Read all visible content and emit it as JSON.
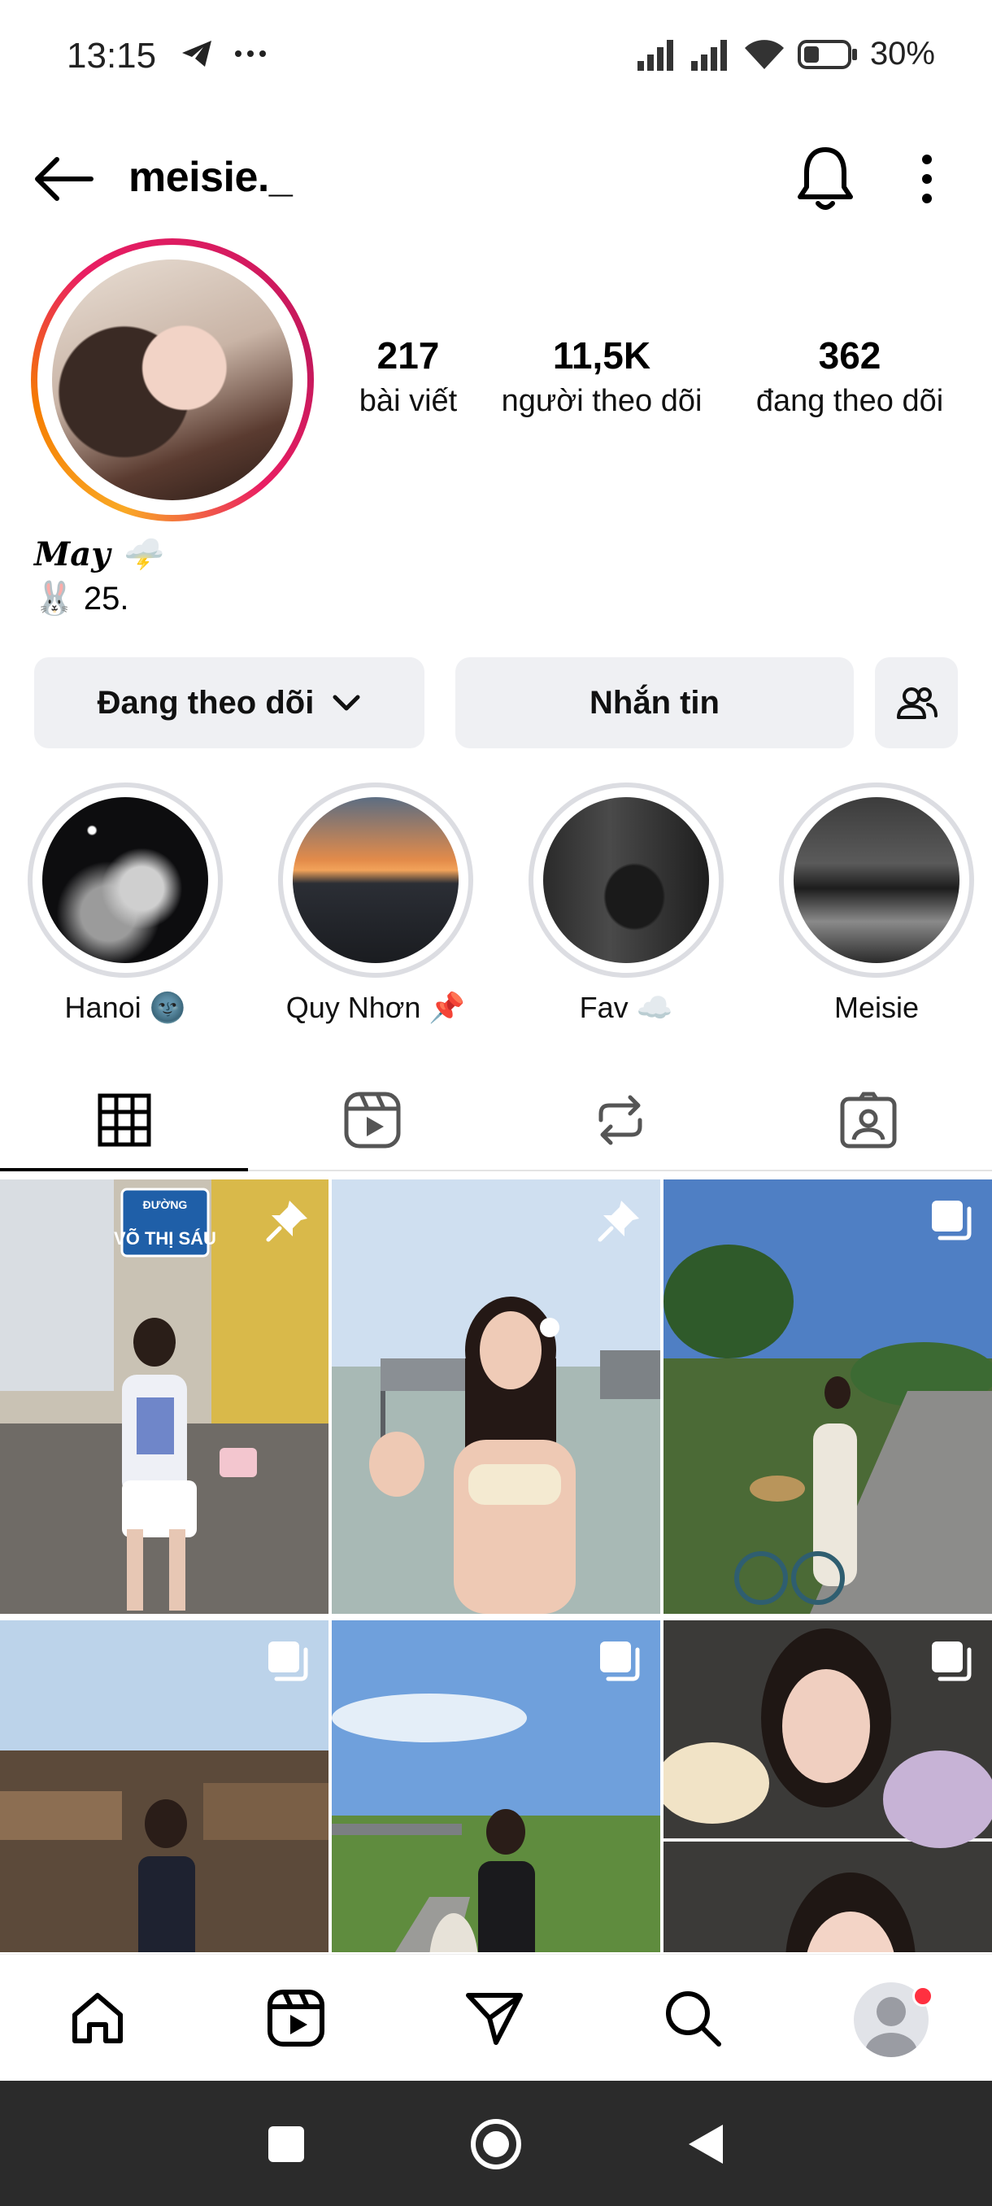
{
  "status_bar": {
    "time": "13:15",
    "battery_text": "30%",
    "icons": [
      "telegram-icon",
      "more-notifications-icon",
      "signal-icon",
      "signal-icon",
      "wifi-icon",
      "battery-icon"
    ]
  },
  "header": {
    "username": "meisie._",
    "icons": [
      "back-arrow-icon",
      "bell-icon",
      "more-vertical-icon"
    ]
  },
  "profile": {
    "stats": [
      {
        "value": "217",
        "label": "bài viết"
      },
      {
        "value": "11,5K",
        "label": "người theo dõi"
      },
      {
        "value": "362",
        "label": "đang theo dõi"
      }
    ],
    "bio_name": "May 🌩️",
    "bio_line": "🐰 25."
  },
  "actions": {
    "following_label": "Đang theo dõi",
    "message_label": "Nhắn tin"
  },
  "highlights": [
    {
      "label": "Hanoi 🌚"
    },
    {
      "label": "Quy Nhơn 📌"
    },
    {
      "label": "Fav ☁️"
    },
    {
      "label": "Meisie"
    }
  ],
  "tabs": [
    "grid-icon",
    "reels-icon",
    "reposts-icon",
    "tagged-icon"
  ],
  "posts": [
    {
      "pinned": true,
      "multi": false
    },
    {
      "pinned": true,
      "multi": false
    },
    {
      "pinned": false,
      "multi": true
    },
    {
      "pinned": false,
      "multi": true
    },
    {
      "pinned": false,
      "multi": true
    },
    {
      "pinned": false,
      "multi": true
    }
  ],
  "post_text": {
    "street_sign_top": "ĐƯỜNG",
    "street_sign_name": "VÕ THỊ SÁU"
  },
  "bottom_nav": [
    "home-icon",
    "reels-icon",
    "direct-icon",
    "search-icon",
    "profile-avatar"
  ],
  "colors": {
    "button_bg": "#eff0f3",
    "notification_dot": "#ff3040",
    "story_ring_start": "#f9a825",
    "story_ring_end": "#d81b60"
  }
}
